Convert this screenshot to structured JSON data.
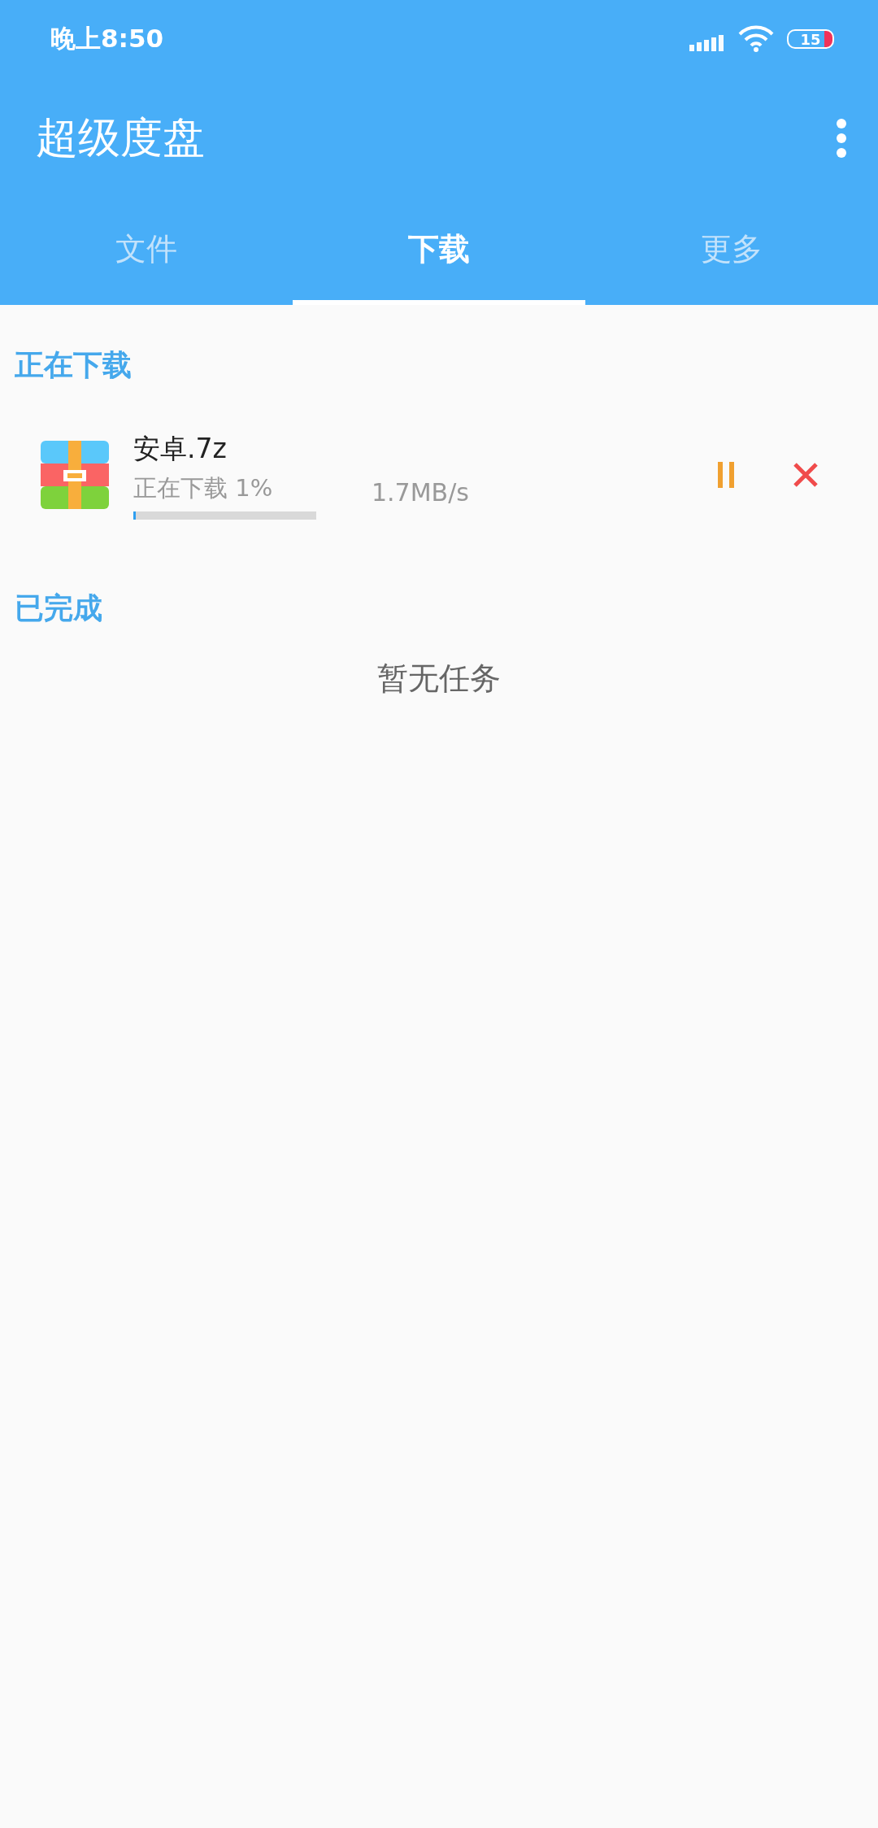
{
  "status_bar": {
    "time": "晚上8:50",
    "battery": "15"
  },
  "app_bar": {
    "title": "超级度盘"
  },
  "tabs": [
    {
      "label": "文件",
      "selected": false
    },
    {
      "label": "下载",
      "selected": true
    },
    {
      "label": "更多",
      "selected": false
    }
  ],
  "downloading": {
    "heading": "正在下载",
    "items": [
      {
        "name": "安卓.7z",
        "status": "正在下载 1%",
        "level": 0.01,
        "speed": "1.7MB/s",
        "paused": false
      }
    ]
  },
  "completed": {
    "heading": "已完成",
    "empty_text": "暂无任务"
  }
}
